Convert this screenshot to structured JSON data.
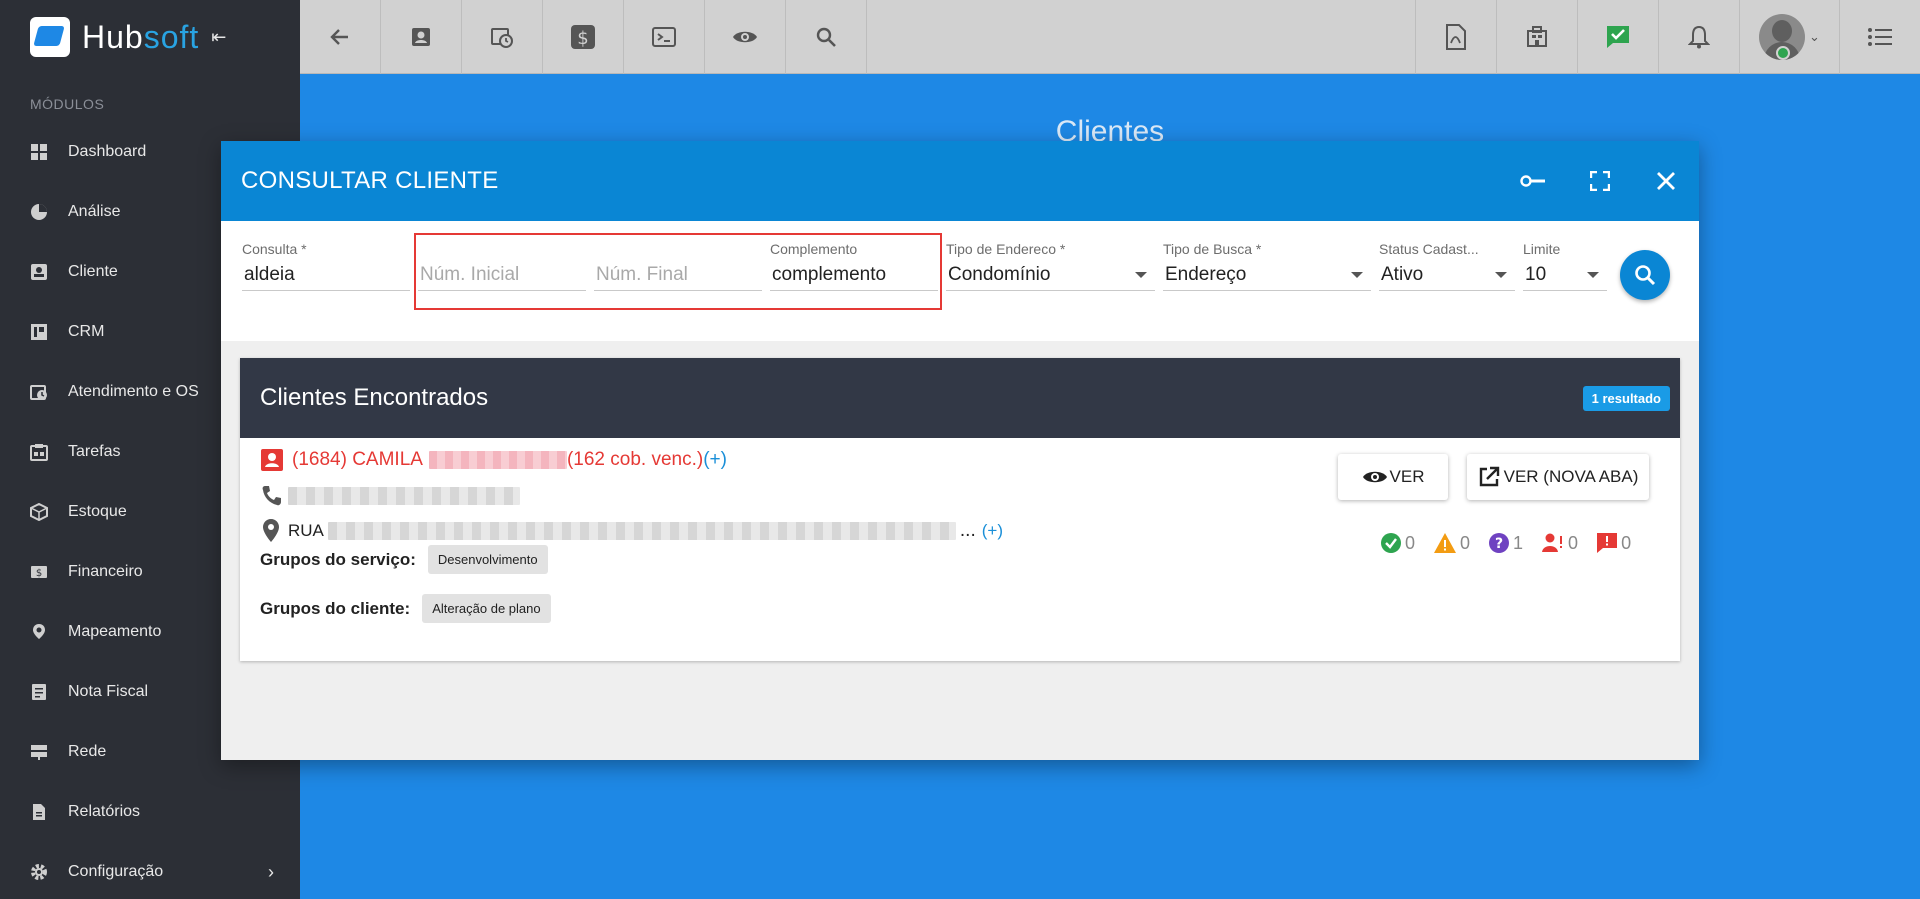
{
  "brand": {
    "part1": "Hub",
    "part2": "soft"
  },
  "sidebar": {
    "section_label": "MÓDULOS",
    "items": [
      {
        "label": "Dashboard",
        "icon": "dashboard-icon"
      },
      {
        "label": "Análise",
        "icon": "pie-chart-icon"
      },
      {
        "label": "Cliente",
        "icon": "contact-card-icon"
      },
      {
        "label": "CRM",
        "icon": "kanban-icon"
      },
      {
        "label": "Atendimento e OS",
        "icon": "calendar-clock-icon"
      },
      {
        "label": "Tarefas",
        "icon": "tasks-icon"
      },
      {
        "label": "Estoque",
        "icon": "box-icon"
      },
      {
        "label": "Financeiro",
        "icon": "money-icon"
      },
      {
        "label": "Mapeamento",
        "icon": "map-pin-icon"
      },
      {
        "label": "Nota Fiscal",
        "icon": "document-icon"
      },
      {
        "label": "Rede",
        "icon": "server-icon"
      },
      {
        "label": "Relatórios",
        "icon": "report-icon"
      },
      {
        "label": "Configuração",
        "icon": "gear-icon"
      }
    ]
  },
  "page": {
    "title": "Clientes"
  },
  "modal": {
    "title": "CONSULTAR CLIENTE",
    "fields": {
      "consulta": {
        "label": "Consulta *",
        "value": "aldeia"
      },
      "num_inicial": {
        "placeholder": "Núm. Inicial"
      },
      "num_final": {
        "placeholder": "Núm. Final"
      },
      "complemento": {
        "label": "Complemento",
        "value": "complemento"
      },
      "tipo_endereco": {
        "label": "Tipo de Endereco *",
        "value": "Condomínio"
      },
      "tipo_busca": {
        "label": "Tipo de Busca *",
        "value": "Endereço"
      },
      "status": {
        "label": "Status Cadast...",
        "value": "Ativo"
      },
      "limite": {
        "label": "Limite",
        "value": "10"
      }
    }
  },
  "results": {
    "title": "Clientes Encontrados",
    "badge": "1 resultado",
    "client": {
      "name_prefix": "(1684) CAMILA",
      "overdue": "(162 cob. venc.)",
      "more": "(+)",
      "address_prefix": "RUA",
      "address_suffix": "...",
      "address_more": "(+)",
      "service_groups_label": "Grupos do serviço:",
      "service_group": "Desenvolvimento",
      "client_groups_label": "Grupos do cliente:",
      "client_group": "Alteração de plano",
      "btn_ver": "VER",
      "btn_ver_nova_aba": "VER (NOVA ABA)",
      "stats": {
        "ok": "0",
        "warning": "0",
        "question": "1",
        "user": "0",
        "alert": "0"
      }
    }
  },
  "colors": {
    "primary": "#0a86d4",
    "danger": "#e53935",
    "sidebar": "#2c2f36"
  }
}
